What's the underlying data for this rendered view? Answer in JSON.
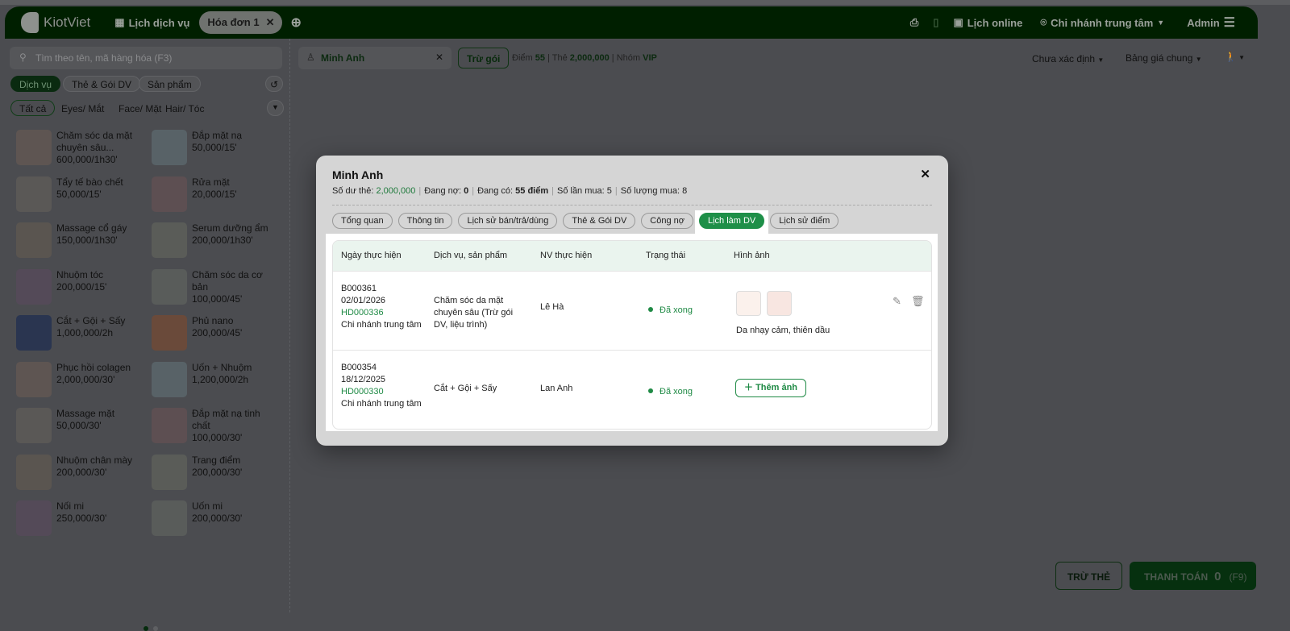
{
  "header": {
    "brand": "KiotViet",
    "schedule": "Lịch dịch vụ",
    "invoice_tab": "Hóa đơn 1",
    "online": "Lịch online",
    "branch": "Chi nhánh trung tâm",
    "user": "Admin"
  },
  "left": {
    "search_placeholder": "Tìm theo tên, mã hàng hóa (F3)",
    "types": [
      "Dịch vụ",
      "Thẻ & Gói DV",
      "Sản phẩm"
    ],
    "categories": [
      "Tất cả",
      "Eyes/ Mắt",
      "Face/ Mặt",
      "Hair/ Tóc"
    ],
    "products": [
      {
        "name": "Chăm sóc da mặt chuyên sâu...",
        "price": "600,000/1h30'"
      },
      {
        "name": "Đắp mặt nạ",
        "price": "50,000/15'"
      },
      {
        "name": "Tẩy tế bào chết",
        "price": "50,000/15'"
      },
      {
        "name": "Rửa mặt",
        "price": "20,000/15'"
      },
      {
        "name": "Massage cổ gáy",
        "price": "150,000/1h30'"
      },
      {
        "name": "Serum dưỡng ẩm",
        "price": "200,000/1h30'"
      },
      {
        "name": "Nhuộm tóc",
        "price": "200,000/15'"
      },
      {
        "name": "Chăm sóc da cơ bản",
        "price": "100,000/45'"
      },
      {
        "name": "Cắt + Gội + Sấy",
        "price": "1,000,000/2h"
      },
      {
        "name": "Phủ nano",
        "price": "200,000/45'"
      },
      {
        "name": "Phục hồi colagen",
        "price": "2,000,000/30'"
      },
      {
        "name": "Uốn + Nhuộm",
        "price": "1,200,000/2h"
      },
      {
        "name": "Massage mặt",
        "price": "50,000/30'"
      },
      {
        "name": "Đắp mặt nạ tinh chất",
        "price": "100,000/30'"
      },
      {
        "name": "Nhuộm chân mày",
        "price": "200,000/30'"
      },
      {
        "name": "Trang điểm",
        "price": "200,000/30'"
      },
      {
        "name": "Nối mi",
        "price": "250,000/30'"
      },
      {
        "name": "Uốn mi",
        "price": "200,000/30'"
      }
    ]
  },
  "order": {
    "customer": "Minh Anh",
    "deduct_package": "Trừ gói",
    "points_label": "Điểm",
    "points": "55",
    "card_label": "Thẻ",
    "card": "2,000,000",
    "group_label": "Nhóm",
    "group": "VIP",
    "status_select": "Chưa xác định",
    "pricebook": "Bảng giá chung",
    "deduct_card": "TRỪ THẺ",
    "pay": "THANH TOÁN",
    "pay_total": "0",
    "pay_key": "(F9)"
  },
  "modal": {
    "title": "Minh Anh",
    "balance_label": "Số dư thẻ:",
    "balance": "2,000,000",
    "debt_label": "Đang nợ:",
    "debt": "0",
    "has_label": "Đang có:",
    "has": "55 điểm",
    "buys_label": "Số lần mua:",
    "buys": "5",
    "qty_label": "Số lượng mua:",
    "qty": "8",
    "tabs": [
      "Tổng quan",
      "Thông tin",
      "Lịch sử bán/trả/dùng",
      "Thẻ & Gói DV",
      "Công nợ",
      "Lịch làm DV",
      "Lịch sử điểm"
    ],
    "columns": [
      "Ngày thực hiện",
      "Dịch vụ, sản phẩm",
      "NV thực hiện",
      "Trạng thái",
      "Hình ảnh"
    ],
    "rows": [
      {
        "code": "B000361",
        "date": "02/01/2026",
        "invoice": "HD000336",
        "branch": "Chi nhánh trung tâm",
        "service": "Chăm sóc da mặt chuyên sâu (Trừ gói DV, liệu trình)",
        "staff": "Lê Hà",
        "status": "Đã xong",
        "note": "Da nhạy cảm, thiên dầu"
      },
      {
        "code": "B000354",
        "date": "18/12/2025",
        "invoice": "HD000330",
        "branch": "Chi nhánh trung tâm",
        "service": "Cắt + Gội + Sấy",
        "staff": "Lan Anh",
        "status": "Đã xong",
        "add_image": "Thêm ảnh"
      }
    ]
  }
}
